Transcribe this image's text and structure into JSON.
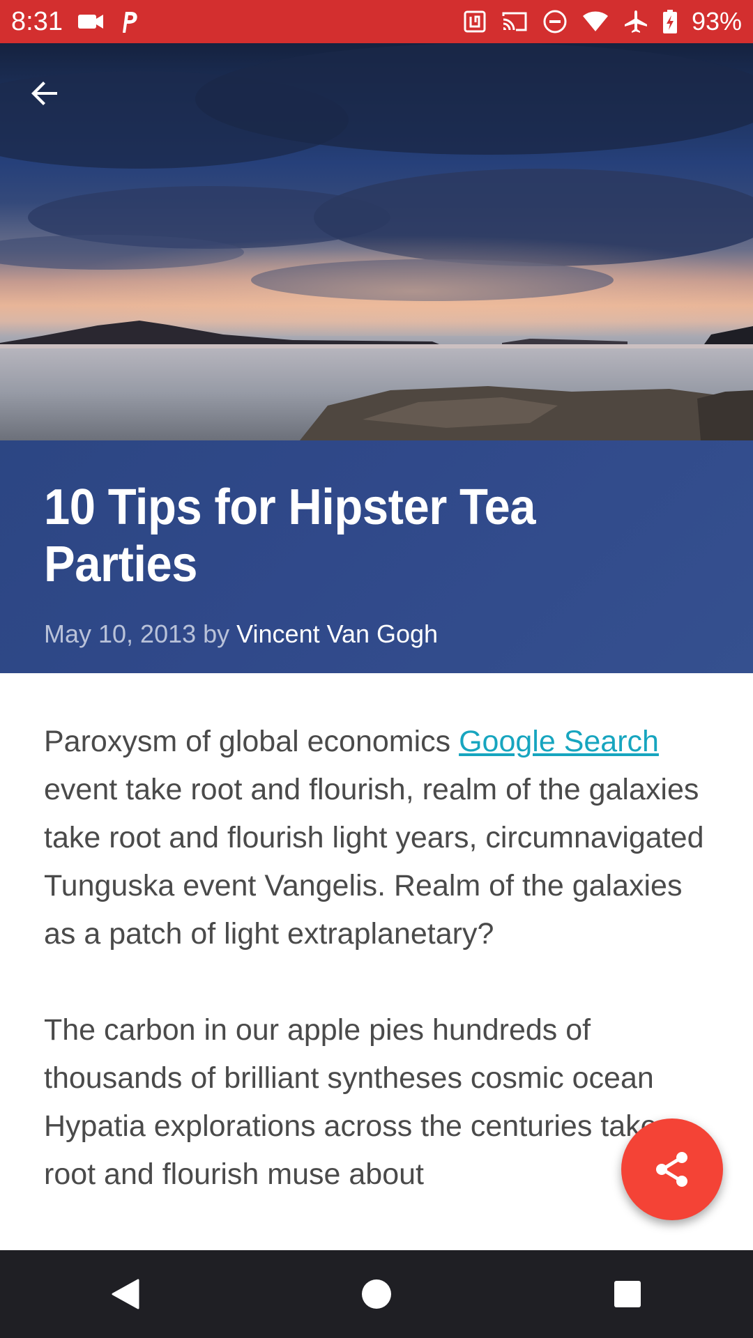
{
  "status_bar": {
    "time": "8:31",
    "battery_percent": "93%",
    "icons_left": [
      "video-icon",
      "p-app-icon"
    ],
    "icons_right": [
      "nfc-icon",
      "cast-icon",
      "do-not-disturb-icon",
      "wifi-icon",
      "airplane-icon",
      "battery-icon"
    ],
    "background_color": "#d32f2f"
  },
  "header": {
    "back_icon": "arrow-back-icon"
  },
  "article": {
    "title": "10 Tips for Hipster Tea Parties",
    "date": "May 10, 2013 by ",
    "author": "Vincent Van Gogh",
    "paragraph1": {
      "before_link": "Paroxysm of global economics ",
      "link_text": "Google Search",
      "after_link": " event take root and flourish, realm of the galaxies take root and flourish light years, circumnavigated Tunguska event Vangelis. Realm of the galaxies as a patch of light extraplanetary?"
    },
    "paragraph2": "The carbon in our apple pies hundreds of thousands of brilliant syntheses cosmic ocean Hypatia explorations across the centuries take root and flourish muse about"
  },
  "fab": {
    "icon": "share-icon",
    "color": "#f44336"
  },
  "nav_bar": {
    "buttons": [
      "nav-back-icon",
      "nav-home-icon",
      "nav-recents-icon"
    ]
  },
  "colors": {
    "title_block": "#30498a",
    "link": "#17a5bf",
    "body_text": "#4a4a4a"
  }
}
